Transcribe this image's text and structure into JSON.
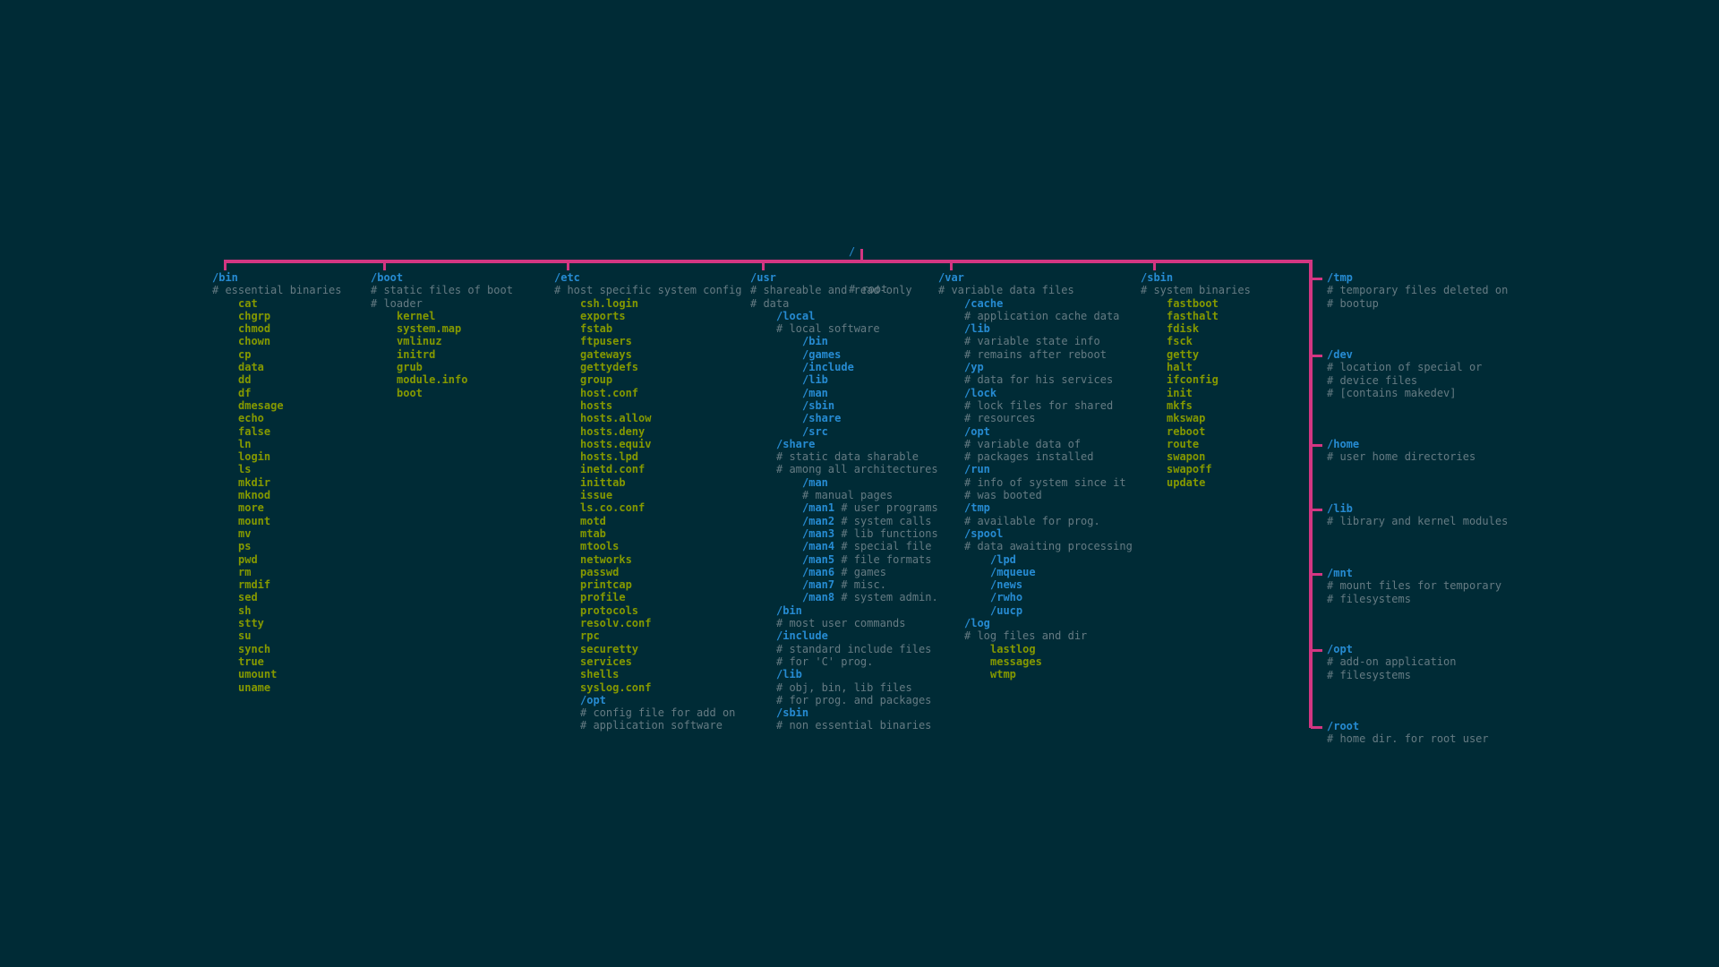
{
  "colors": {
    "background": "#002b36",
    "directory": "#268bd2",
    "file": "#859900",
    "comment": "#657b83",
    "connector": "#d33682"
  },
  "root": {
    "name": "/",
    "comment": "# root"
  },
  "columns": [
    {
      "id": "bin",
      "lines": [
        {
          "t": "/bin",
          "k": "dir",
          "d": 0
        },
        {
          "t": "# essential binaries",
          "k": "cmt",
          "d": 0
        },
        {
          "t": "cat",
          "k": "file",
          "d": 1
        },
        {
          "t": "chgrp",
          "k": "file",
          "d": 1
        },
        {
          "t": "chmod",
          "k": "file",
          "d": 1
        },
        {
          "t": "chown",
          "k": "file",
          "d": 1
        },
        {
          "t": "cp",
          "k": "file",
          "d": 1
        },
        {
          "t": "data",
          "k": "file",
          "d": 1
        },
        {
          "t": "dd",
          "k": "file",
          "d": 1
        },
        {
          "t": "df",
          "k": "file",
          "d": 1
        },
        {
          "t": "dmesage",
          "k": "file",
          "d": 1
        },
        {
          "t": "echo",
          "k": "file",
          "d": 1
        },
        {
          "t": "false",
          "k": "file",
          "d": 1
        },
        {
          "t": "ln",
          "k": "file",
          "d": 1
        },
        {
          "t": "login",
          "k": "file",
          "d": 1
        },
        {
          "t": "ls",
          "k": "file",
          "d": 1
        },
        {
          "t": "mkdir",
          "k": "file",
          "d": 1
        },
        {
          "t": "mknod",
          "k": "file",
          "d": 1
        },
        {
          "t": "more",
          "k": "file",
          "d": 1
        },
        {
          "t": "mount",
          "k": "file",
          "d": 1
        },
        {
          "t": "mv",
          "k": "file",
          "d": 1
        },
        {
          "t": "ps",
          "k": "file",
          "d": 1
        },
        {
          "t": "pwd",
          "k": "file",
          "d": 1
        },
        {
          "t": "rm",
          "k": "file",
          "d": 1
        },
        {
          "t": "rmdif",
          "k": "file",
          "d": 1
        },
        {
          "t": "sed",
          "k": "file",
          "d": 1
        },
        {
          "t": "sh",
          "k": "file",
          "d": 1
        },
        {
          "t": "stty",
          "k": "file",
          "d": 1
        },
        {
          "t": "su",
          "k": "file",
          "d": 1
        },
        {
          "t": "synch",
          "k": "file",
          "d": 1
        },
        {
          "t": "true",
          "k": "file",
          "d": 1
        },
        {
          "t": "umount",
          "k": "file",
          "d": 1
        },
        {
          "t": "uname",
          "k": "file",
          "d": 1
        }
      ]
    },
    {
      "id": "boot",
      "lines": [
        {
          "t": "/boot",
          "k": "dir",
          "d": 0
        },
        {
          "t": "# static files of boot",
          "k": "cmt",
          "d": 0
        },
        {
          "t": "# loader",
          "k": "cmt",
          "d": 0
        },
        {
          "t": "kernel",
          "k": "file",
          "d": 1
        },
        {
          "t": "system.map",
          "k": "file",
          "d": 1
        },
        {
          "t": "vmlinuz",
          "k": "file",
          "d": 1
        },
        {
          "t": "initrd",
          "k": "file",
          "d": 1
        },
        {
          "t": "grub",
          "k": "file",
          "d": 1
        },
        {
          "t": "module.info",
          "k": "file",
          "d": 1
        },
        {
          "t": "boot",
          "k": "file",
          "d": 1
        }
      ]
    },
    {
      "id": "etc",
      "lines": [
        {
          "t": "/etc",
          "k": "dir",
          "d": 0
        },
        {
          "t": "# host specific system config",
          "k": "cmt",
          "d": 0
        },
        {
          "t": "csh.login",
          "k": "file",
          "d": 1
        },
        {
          "t": "exports",
          "k": "file",
          "d": 1
        },
        {
          "t": "fstab",
          "k": "file",
          "d": 1
        },
        {
          "t": "ftpusers",
          "k": "file",
          "d": 1
        },
        {
          "t": "gateways",
          "k": "file",
          "d": 1
        },
        {
          "t": "gettydefs",
          "k": "file",
          "d": 1
        },
        {
          "t": "group",
          "k": "file",
          "d": 1
        },
        {
          "t": "host.conf",
          "k": "file",
          "d": 1
        },
        {
          "t": "hosts",
          "k": "file",
          "d": 1
        },
        {
          "t": "hosts.allow",
          "k": "file",
          "d": 1
        },
        {
          "t": "hosts.deny",
          "k": "file",
          "d": 1
        },
        {
          "t": "hosts.equiv",
          "k": "file",
          "d": 1
        },
        {
          "t": "hosts.lpd",
          "k": "file",
          "d": 1
        },
        {
          "t": "inetd.conf",
          "k": "file",
          "d": 1
        },
        {
          "t": "inittab",
          "k": "file",
          "d": 1
        },
        {
          "t": "issue",
          "k": "file",
          "d": 1
        },
        {
          "t": "ls.co.conf",
          "k": "file",
          "d": 1
        },
        {
          "t": "motd",
          "k": "file",
          "d": 1
        },
        {
          "t": "mtab",
          "k": "file",
          "d": 1
        },
        {
          "t": "mtools",
          "k": "file",
          "d": 1
        },
        {
          "t": "networks",
          "k": "file",
          "d": 1
        },
        {
          "t": "passwd",
          "k": "file",
          "d": 1
        },
        {
          "t": "printcap",
          "k": "file",
          "d": 1
        },
        {
          "t": "profile",
          "k": "file",
          "d": 1
        },
        {
          "t": "protocols",
          "k": "file",
          "d": 1
        },
        {
          "t": "resolv.conf",
          "k": "file",
          "d": 1
        },
        {
          "t": "rpc",
          "k": "file",
          "d": 1
        },
        {
          "t": "securetty",
          "k": "file",
          "d": 1
        },
        {
          "t": "services",
          "k": "file",
          "d": 1
        },
        {
          "t": "shells",
          "k": "file",
          "d": 1
        },
        {
          "t": "syslog.conf",
          "k": "file",
          "d": 1
        },
        {
          "t": "/opt",
          "k": "dir",
          "d": 1
        },
        {
          "t": "# config file for add on",
          "k": "cmt",
          "d": 1
        },
        {
          "t": "# application software",
          "k": "cmt",
          "d": 1
        }
      ]
    },
    {
      "id": "usr",
      "lines": [
        {
          "t": "/usr",
          "k": "dir",
          "d": 0
        },
        {
          "t": "# shareable and read-only",
          "k": "cmt",
          "d": 0
        },
        {
          "t": "# data",
          "k": "cmt",
          "d": 0
        },
        {
          "t": "/local",
          "k": "dir",
          "d": 1
        },
        {
          "t": "# local software",
          "k": "cmt",
          "d": 1
        },
        {
          "t": "/bin",
          "k": "dir",
          "d": 2
        },
        {
          "t": "/games",
          "k": "dir",
          "d": 2
        },
        {
          "t": "/include",
          "k": "dir",
          "d": 2
        },
        {
          "t": "/lib",
          "k": "dir",
          "d": 2
        },
        {
          "t": "/man",
          "k": "dir",
          "d": 2
        },
        {
          "t": "/sbin",
          "k": "dir",
          "d": 2
        },
        {
          "t": "/share",
          "k": "dir",
          "d": 2
        },
        {
          "t": "/src",
          "k": "dir",
          "d": 2
        },
        {
          "t": "/share",
          "k": "dir",
          "d": 1
        },
        {
          "t": "# static data sharable",
          "k": "cmt",
          "d": 1
        },
        {
          "t": "# among all architectures",
          "k": "cmt",
          "d": 1
        },
        {
          "t": "/man",
          "k": "dir",
          "d": 2
        },
        {
          "t": "# manual pages",
          "k": "cmt",
          "d": 2
        },
        {
          "t": "/man1",
          "k": "dir",
          "d": 2,
          "c": " # user programs"
        },
        {
          "t": "/man2",
          "k": "dir",
          "d": 2,
          "c": " # system calls"
        },
        {
          "t": "/man3",
          "k": "dir",
          "d": 2,
          "c": " # lib functions"
        },
        {
          "t": "/man4",
          "k": "dir",
          "d": 2,
          "c": " # special file"
        },
        {
          "t": "/man5",
          "k": "dir",
          "d": 2,
          "c": " # file formats"
        },
        {
          "t": "/man6",
          "k": "dir",
          "d": 2,
          "c": " # games"
        },
        {
          "t": "/man7",
          "k": "dir",
          "d": 2,
          "c": " # misc."
        },
        {
          "t": "/man8",
          "k": "dir",
          "d": 2,
          "c": " # system admin."
        },
        {
          "t": "/bin",
          "k": "dir",
          "d": 1
        },
        {
          "t": "# most user commands",
          "k": "cmt",
          "d": 1
        },
        {
          "t": "/include",
          "k": "dir",
          "d": 1
        },
        {
          "t": "# standard include files",
          "k": "cmt",
          "d": 1
        },
        {
          "t": "# for 'C' prog.",
          "k": "cmt",
          "d": 1
        },
        {
          "t": "/lib",
          "k": "dir",
          "d": 1
        },
        {
          "t": "# obj, bin, lib files",
          "k": "cmt",
          "d": 1
        },
        {
          "t": "# for prog. and packages",
          "k": "cmt",
          "d": 1
        },
        {
          "t": "/sbin",
          "k": "dir",
          "d": 1
        },
        {
          "t": "# non essential binaries",
          "k": "cmt",
          "d": 1
        }
      ]
    },
    {
      "id": "var",
      "lines": [
        {
          "t": "/var",
          "k": "dir",
          "d": 0
        },
        {
          "t": "# variable data files",
          "k": "cmt",
          "d": 0
        },
        {
          "t": "/cache",
          "k": "dir",
          "d": 1
        },
        {
          "t": "# application cache data",
          "k": "cmt",
          "d": 1
        },
        {
          "t": "/lib",
          "k": "dir",
          "d": 1
        },
        {
          "t": "# variable state info",
          "k": "cmt",
          "d": 1
        },
        {
          "t": "# remains after reboot",
          "k": "cmt",
          "d": 1
        },
        {
          "t": "/yp",
          "k": "dir",
          "d": 1
        },
        {
          "t": "# data for his services",
          "k": "cmt",
          "d": 1
        },
        {
          "t": "/lock",
          "k": "dir",
          "d": 1
        },
        {
          "t": "# lock files for shared",
          "k": "cmt",
          "d": 1
        },
        {
          "t": "# resources",
          "k": "cmt",
          "d": 1
        },
        {
          "t": "/opt",
          "k": "dir",
          "d": 1
        },
        {
          "t": "# variable data of",
          "k": "cmt",
          "d": 1
        },
        {
          "t": "# packages installed",
          "k": "cmt",
          "d": 1
        },
        {
          "t": "/run",
          "k": "dir",
          "d": 1
        },
        {
          "t": "# info of system since it",
          "k": "cmt",
          "d": 1
        },
        {
          "t": "# was booted",
          "k": "cmt",
          "d": 1
        },
        {
          "t": "/tmp",
          "k": "dir",
          "d": 1
        },
        {
          "t": "# available for prog.",
          "k": "cmt",
          "d": 1
        },
        {
          "t": "/spool",
          "k": "dir",
          "d": 1
        },
        {
          "t": "# data awaiting processing",
          "k": "cmt",
          "d": 1
        },
        {
          "t": "/lpd",
          "k": "dir",
          "d": 2
        },
        {
          "t": "/mqueue",
          "k": "dir",
          "d": 2
        },
        {
          "t": "/news",
          "k": "dir",
          "d": 2
        },
        {
          "t": "/rwho",
          "k": "dir",
          "d": 2
        },
        {
          "t": "/uucp",
          "k": "dir",
          "d": 2
        },
        {
          "t": "/log",
          "k": "dir",
          "d": 1
        },
        {
          "t": "# log files and dir",
          "k": "cmt",
          "d": 1
        },
        {
          "t": "lastlog",
          "k": "file",
          "d": 2
        },
        {
          "t": "messages",
          "k": "file",
          "d": 2
        },
        {
          "t": "wtmp",
          "k": "file",
          "d": 2
        }
      ]
    },
    {
      "id": "sbin",
      "lines": [
        {
          "t": "/sbin",
          "k": "dir",
          "d": 0
        },
        {
          "t": "# system binaries",
          "k": "cmt",
          "d": 0
        },
        {
          "t": "fastboot",
          "k": "file",
          "d": 1
        },
        {
          "t": "fasthalt",
          "k": "file",
          "d": 1
        },
        {
          "t": "fdisk",
          "k": "file",
          "d": 1
        },
        {
          "t": "fsck",
          "k": "file",
          "d": 1
        },
        {
          "t": "getty",
          "k": "file",
          "d": 1
        },
        {
          "t": "halt",
          "k": "file",
          "d": 1
        },
        {
          "t": "ifconfig",
          "k": "file",
          "d": 1
        },
        {
          "t": "init",
          "k": "file",
          "d": 1
        },
        {
          "t": "mkfs",
          "k": "file",
          "d": 1
        },
        {
          "t": "mkswap",
          "k": "file",
          "d": 1
        },
        {
          "t": "reboot",
          "k": "file",
          "d": 1
        },
        {
          "t": "route",
          "k": "file",
          "d": 1
        },
        {
          "t": "swapon",
          "k": "file",
          "d": 1
        },
        {
          "t": "swapoff",
          "k": "file",
          "d": 1
        },
        {
          "t": "update",
          "k": "file",
          "d": 1
        }
      ]
    }
  ],
  "right_branches": [
    {
      "name": "/tmp",
      "comments": [
        "# temporary files deleted on",
        "# bootup"
      ]
    },
    {
      "name": "/dev",
      "comments": [
        "# location of special or",
        "# device files",
        "# [contains makedev]"
      ]
    },
    {
      "name": "/home",
      "comments": [
        "# user home directories"
      ]
    },
    {
      "name": "/lib",
      "comments": [
        "# library and kernel modules"
      ]
    },
    {
      "name": "/mnt",
      "comments": [
        "# mount files for temporary",
        "# filesystems"
      ]
    },
    {
      "name": "/opt",
      "comments": [
        "# add-on application",
        "# filesystems"
      ]
    },
    {
      "name": "/root",
      "comments": [
        "# home dir. for root user"
      ]
    }
  ]
}
